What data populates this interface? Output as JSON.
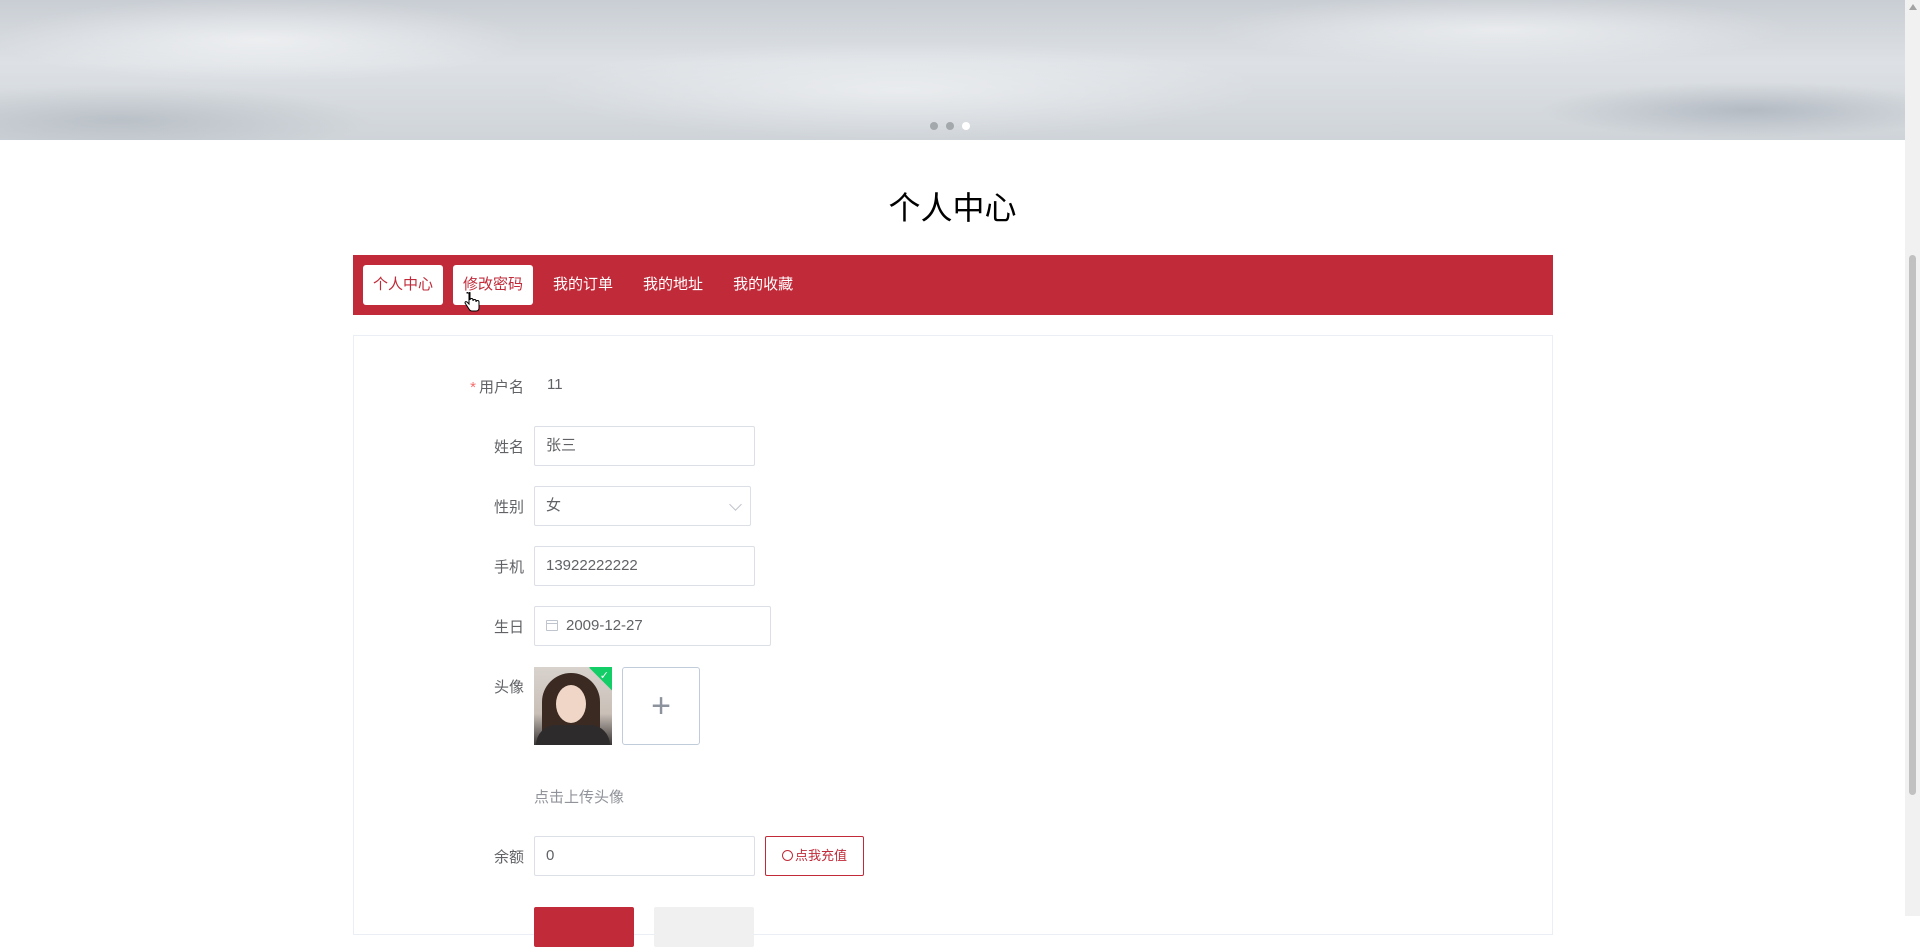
{
  "banner": {
    "slides": 3,
    "active_index": 2
  },
  "page_title": "个人中心",
  "tabs": [
    {
      "label": "个人中心",
      "active": true
    },
    {
      "label": "修改密码",
      "active": true
    },
    {
      "label": "我的订单",
      "active": false
    },
    {
      "label": "我的地址",
      "active": false
    },
    {
      "label": "我的收藏",
      "active": false
    }
  ],
  "form": {
    "username": {
      "label": "用户名",
      "required_mark": "*",
      "value": "11"
    },
    "name": {
      "label": "姓名",
      "value": "张三"
    },
    "gender": {
      "label": "性别",
      "value": "女"
    },
    "phone": {
      "label": "手机",
      "value": "13922222222"
    },
    "birthday": {
      "label": "生日",
      "value": "2009-12-27"
    },
    "avatar": {
      "label": "头像",
      "upload_icon": "plus-icon",
      "hint": "点击上传头像"
    },
    "balance": {
      "label": "余额",
      "value": "0",
      "recharge_label": "点我充值"
    }
  },
  "colors": {
    "accent": "#c12a39",
    "success": "#13ce66"
  }
}
